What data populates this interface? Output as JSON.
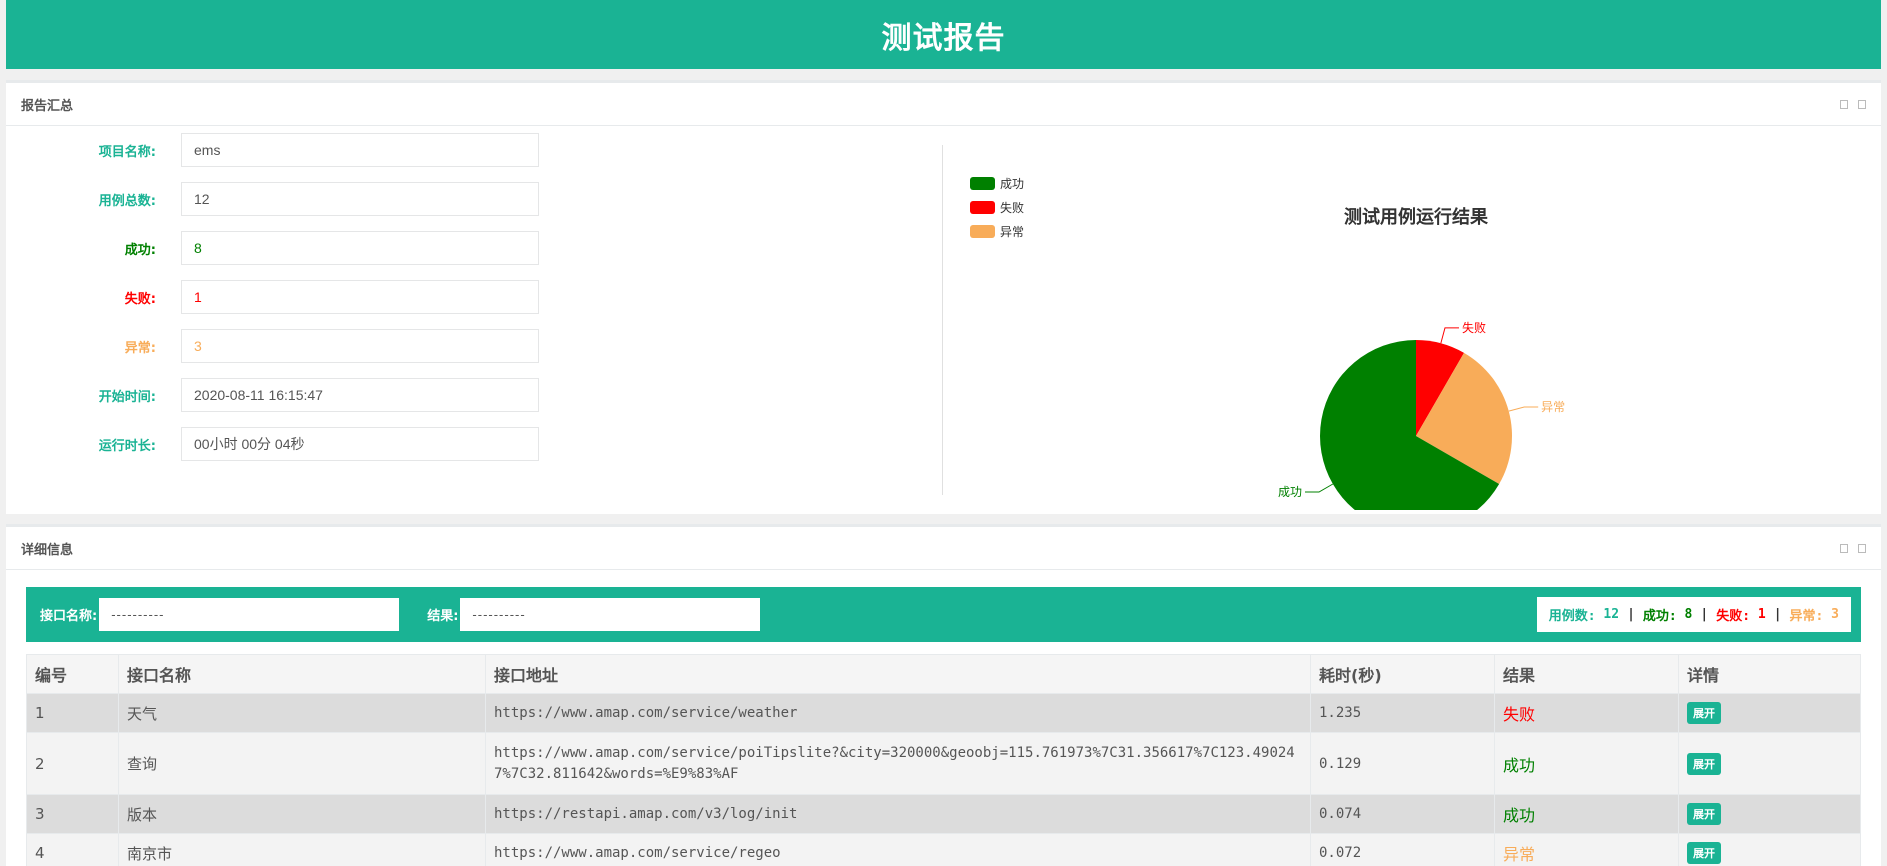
{
  "header": {
    "title": "测试报告"
  },
  "summary": {
    "title": "报告汇总",
    "fields": [
      {
        "label": "项目名称:",
        "value": "ems",
        "label_color": "#1ab394",
        "value_color": "#555555"
      },
      {
        "label": "用例总数:",
        "value": "12",
        "label_color": "#1ab394",
        "value_color": "#555555"
      },
      {
        "label": "成功:",
        "value": "8",
        "label_color": "#008000",
        "value_color": "#008000"
      },
      {
        "label": "失败:",
        "value": "1",
        "label_color": "#ff0000",
        "value_color": "#ff0000"
      },
      {
        "label": "异常:",
        "value": "3",
        "label_color": "#f8ac59",
        "value_color": "#f8ac59"
      },
      {
        "label": "开始时间:",
        "value": "2020-08-11 16:15:47",
        "label_color": "#1ab394",
        "value_color": "#555555"
      },
      {
        "label": "运行时长:",
        "value": "00小时 00分 04秒",
        "label_color": "#1ab394",
        "value_color": "#555555"
      }
    ]
  },
  "chart_data": {
    "type": "pie",
    "title": "测试用例运行结果",
    "categories": [
      "成功",
      "失败",
      "异常"
    ],
    "values": [
      8,
      1,
      3
    ],
    "colors": [
      "#008000",
      "#ff0000",
      "#f8ac59"
    ],
    "legend": "top-left"
  },
  "detail": {
    "title": "详细信息",
    "filter": {
      "name_label": "接口名称:",
      "name_value": "----------",
      "result_label": "结果:",
      "result_value": "----------"
    },
    "stats": {
      "total_label": "用例数:",
      "total": "12",
      "success_label": "成功:",
      "success": "8",
      "fail_label": "失败:",
      "fail": "1",
      "error_label": "异常:",
      "error": "3",
      "sep": "|"
    },
    "columns": [
      "编号",
      "接口名称",
      "接口地址",
      "耗时(秒)",
      "结果",
      "详情"
    ],
    "rows": [
      {
        "id": "1",
        "name": "天气",
        "url": "https://www.amap.com/service/weather",
        "time": "1.235",
        "result": "失败",
        "result_color": "#ff0000",
        "action": "展开"
      },
      {
        "id": "2",
        "name": "查询",
        "url": "https://www.amap.com/service/poiTipslite?&city=320000&geoobj=115.761973%7C31.356617%7C123.490247%7C32.811642&words=%E9%83%AF",
        "time": "0.129",
        "result": "成功",
        "result_color": "#008000",
        "action": "展开"
      },
      {
        "id": "3",
        "name": "版本",
        "url": "https://restapi.amap.com/v3/log/init",
        "time": "0.074",
        "result": "成功",
        "result_color": "#008000",
        "action": "展开"
      },
      {
        "id": "4",
        "name": "南京市",
        "url": "https://www.amap.com/service/regeo",
        "time": "0.072",
        "result": "异常",
        "result_color": "#f8ac59",
        "action": "展开"
      }
    ]
  }
}
